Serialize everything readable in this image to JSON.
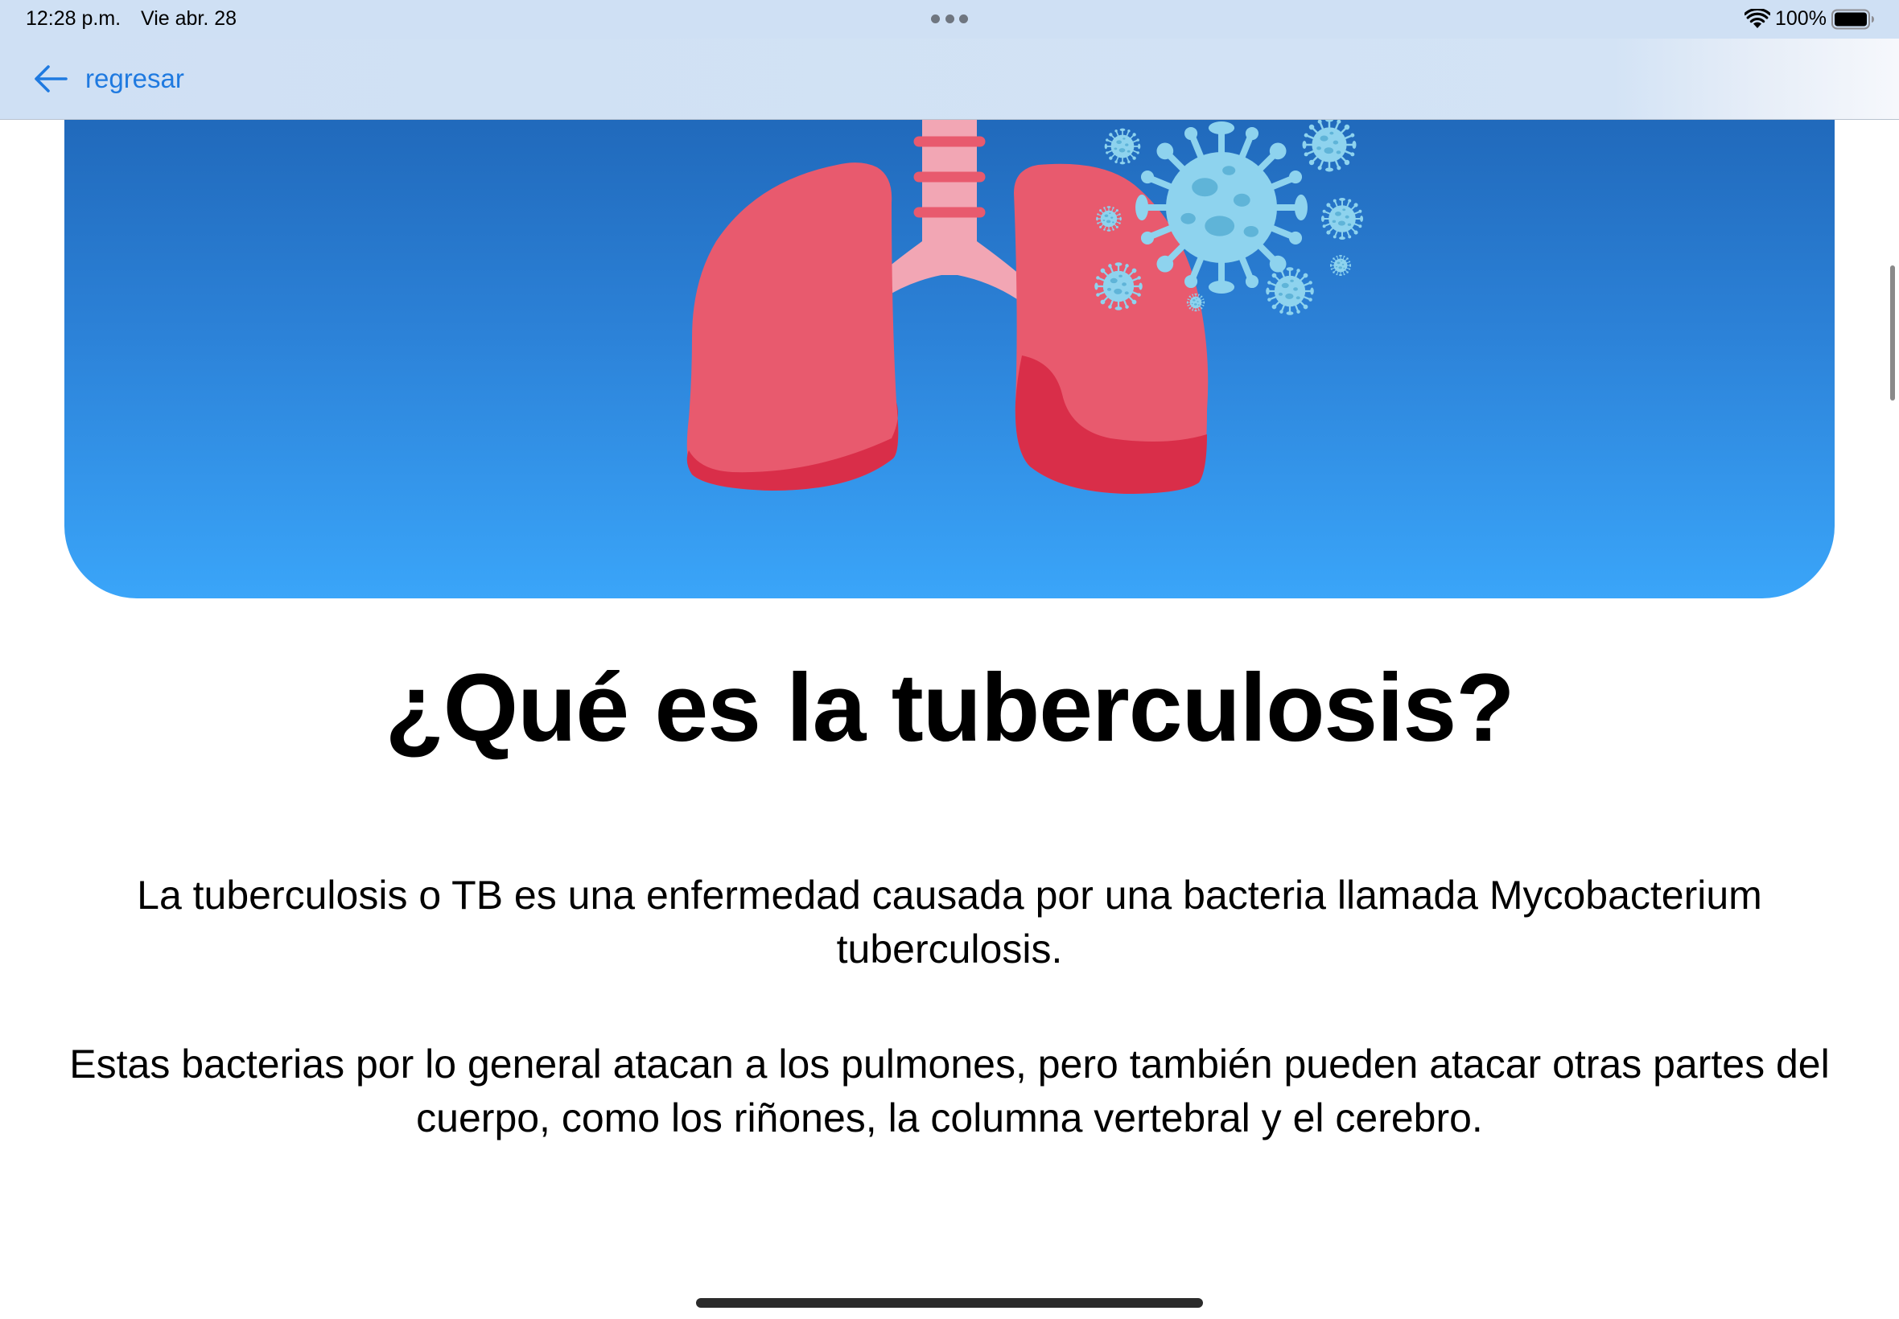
{
  "status_bar": {
    "time": "12:28 p.m.",
    "date": "Vie abr. 28",
    "battery": "100%"
  },
  "nav": {
    "back_label": "regresar"
  },
  "hero": {
    "image_subject": "lungs-with-virus-illustration"
  },
  "content": {
    "title": "¿Qué es la tuberculosis?",
    "paragraphs": [
      "La tuberculosis o TB es una enfermedad causada por una bacteria llamada Mycobacterium tuberculosis.",
      "Estas bacterias por lo general atacan a los pulmones, pero también pueden atacar otras partes del cuerpo, como los riñones, la columna vertebral y el cerebro."
    ]
  },
  "colors": {
    "accent": "#1f7ae0",
    "nav_background": "#cfe0f4",
    "banner_top": "#1e64b5",
    "banner_bottom": "#3aa5f9",
    "lung": "#e85a6e",
    "lung_dark": "#d92e49",
    "trachea": "#f2a6b4",
    "virus": "#8ed3ee"
  },
  "icons": [
    "back-arrow-icon",
    "wifi-icon",
    "battery-icon",
    "multitask-dots-icon"
  ]
}
